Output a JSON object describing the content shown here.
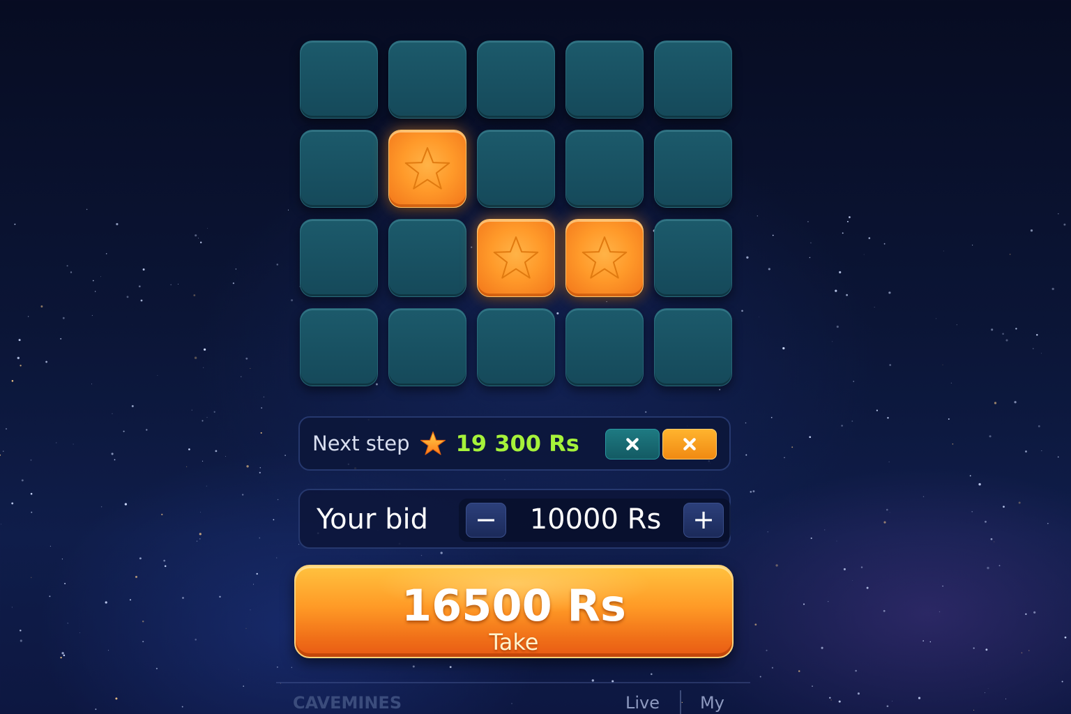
{
  "game": {
    "grid": {
      "rows": 4,
      "cols": 5,
      "revealed_cells": [
        [
          1,
          1
        ],
        [
          2,
          2
        ],
        [
          2,
          3
        ]
      ],
      "revealed_icon": "star-icon"
    }
  },
  "next_step": {
    "label": "Next step",
    "icon": "star-icon",
    "amount": "19 300 Rs",
    "amount_color": "#a6f23a"
  },
  "bid": {
    "label": "Your bid",
    "value": "10000 Rs",
    "decrease_symbol": "−",
    "increase_symbol": "+"
  },
  "take": {
    "amount": "16500 Rs",
    "label": "Take"
  },
  "footer": {
    "brand": "CAVEMINES",
    "tabs": [
      "Live",
      "My"
    ]
  },
  "colors": {
    "accent_orange": "#ff9a26",
    "tile_teal": "#1c5a6b",
    "background": "#0b1536"
  }
}
